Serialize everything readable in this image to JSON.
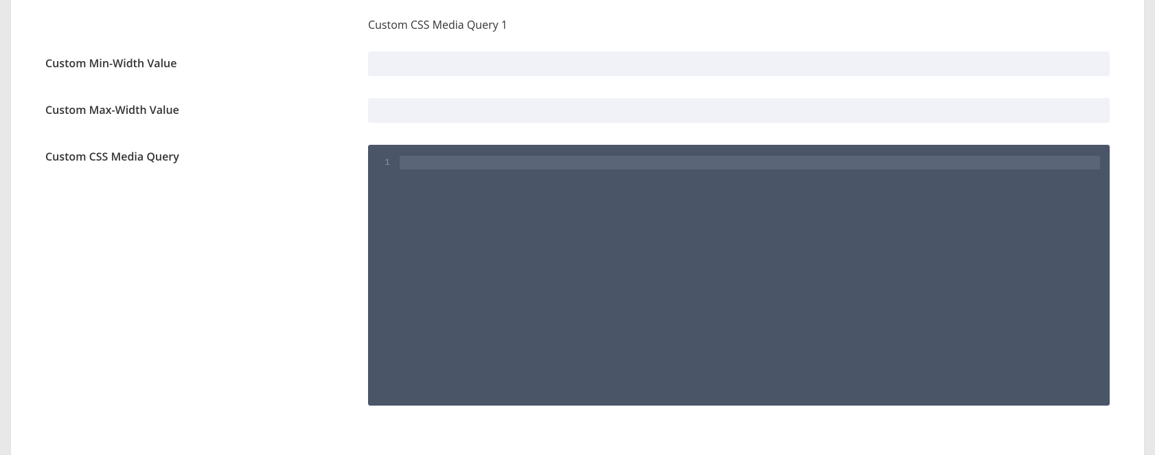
{
  "section": {
    "title": "Custom CSS Media Query 1"
  },
  "fields": {
    "min_width": {
      "label": "Custom Min-Width Value",
      "value": ""
    },
    "max_width": {
      "label": "Custom Max-Width Value",
      "value": ""
    },
    "css_query": {
      "label": "Custom CSS Media Query",
      "line_number": "1",
      "value": ""
    }
  }
}
